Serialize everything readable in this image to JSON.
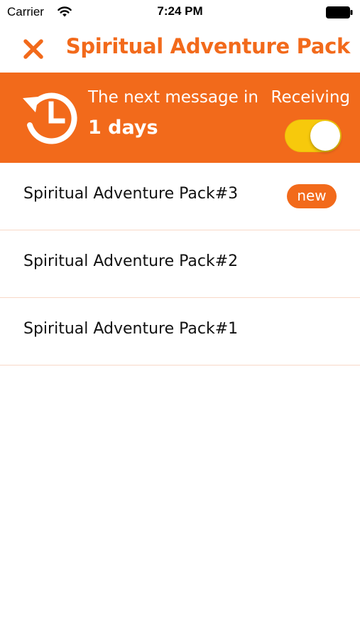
{
  "status_bar": {
    "carrier": "Carrier",
    "time": "7:24 PM"
  },
  "nav": {
    "title": "Spiritual Adventure Pack",
    "close_icon": "close-icon"
  },
  "banner": {
    "icon": "history-clock-icon",
    "next_message_text": "The next message in",
    "days_text": "1 days",
    "receiving_label": "Receiving",
    "receiving_on": true
  },
  "items": [
    {
      "title": "Spiritual Adventure Pack#3",
      "badge": "new"
    },
    {
      "title": "Spiritual Adventure Pack#2",
      "badge": ""
    },
    {
      "title": "Spiritual Adventure Pack#1",
      "badge": ""
    }
  ],
  "colors": {
    "accent": "#F26A1B",
    "toggle_on": "#F7C90C",
    "divider": "#F8D9C8"
  }
}
